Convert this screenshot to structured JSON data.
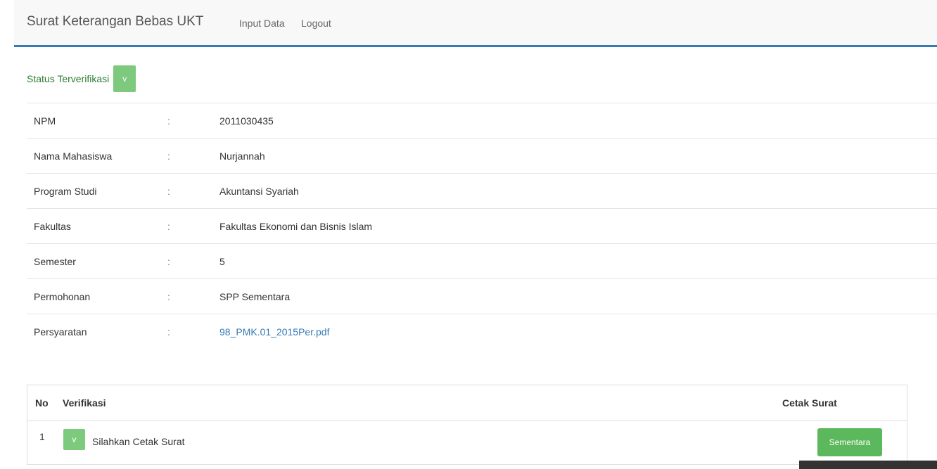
{
  "navbar": {
    "brand": "Surat Keterangan Bebas UKT",
    "links": [
      "Input Data",
      "Logout"
    ]
  },
  "status": {
    "label": "Status Terverifikasi",
    "badge": "v"
  },
  "info_rows": [
    {
      "label": "NPM",
      "sep": ":",
      "value": "2011030435"
    },
    {
      "label": "Nama Mahasiswa",
      "sep": ":",
      "value": "Nurjannah"
    },
    {
      "label": "Program Studi",
      "sep": ":",
      "value": "Akuntansi Syariah"
    },
    {
      "label": "Fakultas",
      "sep": ":",
      "value": "Fakultas Ekonomi dan Bisnis Islam"
    },
    {
      "label": "Semester",
      "sep": ":",
      "value": "5"
    },
    {
      "label": "Permohonan",
      "sep": ":",
      "value": "SPP Sementara"
    },
    {
      "label": "Persyaratan",
      "sep": ":",
      "value": "98_PMK.01_2015Per.pdf"
    }
  ],
  "verification_table": {
    "headers": [
      "No",
      "Verifikasi",
      "Cetak Surat"
    ],
    "rows": [
      {
        "no": "1",
        "badge": "v",
        "text": "Silahkan Cetak Surat",
        "button": "Sementara"
      }
    ]
  },
  "colors": {
    "accent": "#337ab7",
    "success": "#5cb85c",
    "success_light": "#7dc97d",
    "status_text": "#2e7d32"
  }
}
